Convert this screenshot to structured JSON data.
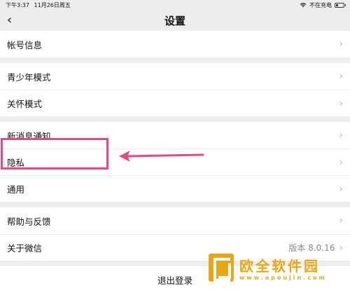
{
  "status_bar": {
    "time": "下午3:37",
    "date": "11月26日周五",
    "charging": "不在充电"
  },
  "nav": {
    "title": "设置",
    "back_glyph": "‹"
  },
  "groups": [
    {
      "items": [
        {
          "label": "帐号信息"
        }
      ]
    },
    {
      "items": [
        {
          "label": "青少年模式"
        },
        {
          "label": "关怀模式"
        }
      ]
    },
    {
      "items": [
        {
          "label": "新消息通知"
        },
        {
          "label": "隐私"
        },
        {
          "label": "通用"
        }
      ]
    },
    {
      "items": [
        {
          "label": "帮助与反馈"
        },
        {
          "label": "关于微信",
          "value": "版本 8.0.16"
        }
      ]
    }
  ],
  "logout_label": "退出登录",
  "chevron": "›",
  "annotation": {
    "color": "#e8477f",
    "target": "隐私"
  },
  "battery_level": 0.25,
  "watermark": {
    "title": "欧全软件园",
    "url": "www.apoujin.com",
    "color": "#e9a617"
  }
}
